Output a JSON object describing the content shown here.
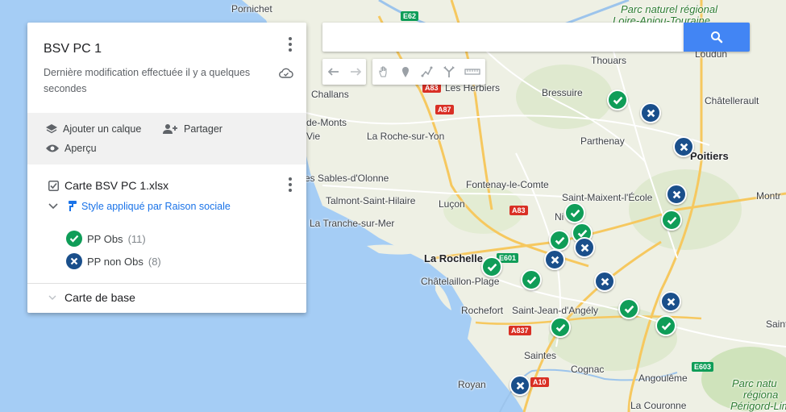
{
  "map": {
    "labels": {
      "pornichet": "Pornichet",
      "parc_top": "Parc naturel régional",
      "loire_anjou": "Loire-Anjou-Touraine",
      "loudun": "Loudun",
      "thouars": "Thouars",
      "challans": "Challans",
      "les_herbiers": "Les Herbiers",
      "bressuire": "Bressuire",
      "chatellerault": "Châtellerault",
      "de_monts": "de-Monts",
      "vie": "Vie",
      "roche_sur_yon": "La Roche-sur-Yon",
      "parthenay": "Parthenay",
      "poitiers": "Poitiers",
      "sables": "es Sables-d'Olonne",
      "fontenay": "Fontenay-le-Comte",
      "talmont": "Talmont-Saint-Hilaire",
      "lucon": "Luçon",
      "st_maixent": "Saint-Maixent-l'École",
      "montmorillon": "Montr",
      "tranche": "La Tranche-sur-Mer",
      "niort": "Ni",
      "la_rochelle": "La Rochelle",
      "chatelaillon": "Châtelaillon-Plage",
      "rochefort": "Rochefort",
      "st_jean": "Saint-Jean-d'Angély",
      "saint": "Saint",
      "saintes": "Saintes",
      "cognac": "Cognac",
      "royan": "Royan",
      "angouleme": "Angoulême",
      "parc_bottom1": "Parc natu",
      "parc_bottom2": "régiona",
      "parc_bottom3": "Périgord-Lim",
      "la_couronne": "La Couronne"
    },
    "roads": {
      "e62": "E62",
      "a83_top": "A83",
      "a87": "A87",
      "a83": "A83",
      "e601": "E601",
      "a837": "A837",
      "a10": "A10",
      "e603": "E603"
    },
    "markers": [
      {
        "type": "obs"
      },
      {
        "type": "non_obs"
      },
      {
        "type": "non_obs"
      },
      {
        "type": "non_obs"
      },
      {
        "type": "obs"
      },
      {
        "type": "obs"
      },
      {
        "type": "obs"
      },
      {
        "type": "obs"
      },
      {
        "type": "non_obs"
      },
      {
        "type": "non_obs"
      },
      {
        "type": "obs"
      },
      {
        "type": "obs"
      },
      {
        "type": "non_obs"
      },
      {
        "type": "obs"
      },
      {
        "type": "non_obs"
      },
      {
        "type": "obs"
      },
      {
        "type": "obs"
      },
      {
        "type": "non_obs"
      }
    ]
  },
  "panel": {
    "title": "BSV PC 1",
    "description": "Dernière modification effectuée il y a quelques secondes",
    "add_layer": "Ajouter un calque",
    "share": "Partager",
    "preview": "Aperçu",
    "layer_name": "Carte BSV PC 1.xlsx",
    "style_label": "Style appliqué par Raison sociale",
    "legend": [
      {
        "label": "PP Obs",
        "count": "(11)",
        "type": "obs"
      },
      {
        "label": "PP non Obs",
        "count": "(8)",
        "type": "non_obs"
      }
    ],
    "base_map": "Carte de base"
  },
  "search": {
    "value": "",
    "placeholder": ""
  },
  "colors": {
    "obs": "#0f9d58",
    "non_obs": "#1a4f8b",
    "accent": "#4285f4",
    "link": "#1a73e8",
    "sea": "#a5cdf5",
    "land": "#eef0e4"
  },
  "icons": {
    "search": "search-icon",
    "undo": "undo-icon",
    "redo": "redo-icon",
    "pan": "hand-icon",
    "marker": "add-marker-icon",
    "line": "draw-line-icon",
    "directions": "directions-icon",
    "measure": "ruler-icon",
    "cloud": "cloud-saved-icon",
    "layers": "layers-icon",
    "share": "add-person-icon",
    "preview": "eye-icon",
    "paint": "paint-roller-icon"
  }
}
